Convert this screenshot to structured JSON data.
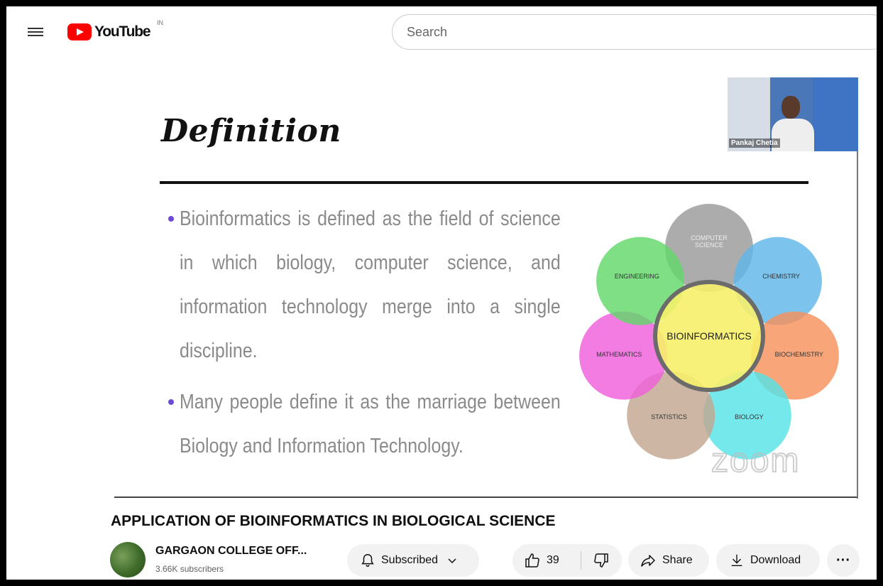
{
  "header": {
    "logo_text": "YouTube",
    "country_code": "IN",
    "search_placeholder": "Search"
  },
  "slide": {
    "title": "Definition",
    "bullets": [
      "Bioinformatics is defined as the field of science in which biology, computer science, and information technology merge into a single discipline.",
      "Many people define it as the marriage between Biology and Information Technology."
    ],
    "webcam_name": "Pankaj Chetia",
    "diagram": {
      "center": "BIOINFORMATICS",
      "petals": [
        {
          "label": "COMPUTER SCIENCE",
          "color": "#9a9a9a"
        },
        {
          "label": "CHEMISTRY",
          "color": "#5fb6e9"
        },
        {
          "label": "BIOCHEMISTRY",
          "color": "#f6935c"
        },
        {
          "label": "BIOLOGY",
          "color": "#55e3e6"
        },
        {
          "label": "STATISTICS",
          "color": "#c2a68f"
        },
        {
          "label": "MATHEMATICS",
          "color": "#ef5fdc"
        },
        {
          "label": "ENGINEERING",
          "color": "#61d86a"
        }
      ],
      "center_color": "#f6ef6a"
    },
    "watermark": "zoom"
  },
  "video": {
    "title": "APPLICATION OF BIOINFORMATICS IN BIOLOGICAL SCIENCE"
  },
  "channel": {
    "name": "GARGAON COLLEGE OFF...",
    "subscribers": "3.66K subscribers"
  },
  "actions": {
    "subscribed_label": "Subscribed",
    "like_count": "39",
    "share_label": "Share",
    "download_label": "Download",
    "more_label": "···"
  }
}
